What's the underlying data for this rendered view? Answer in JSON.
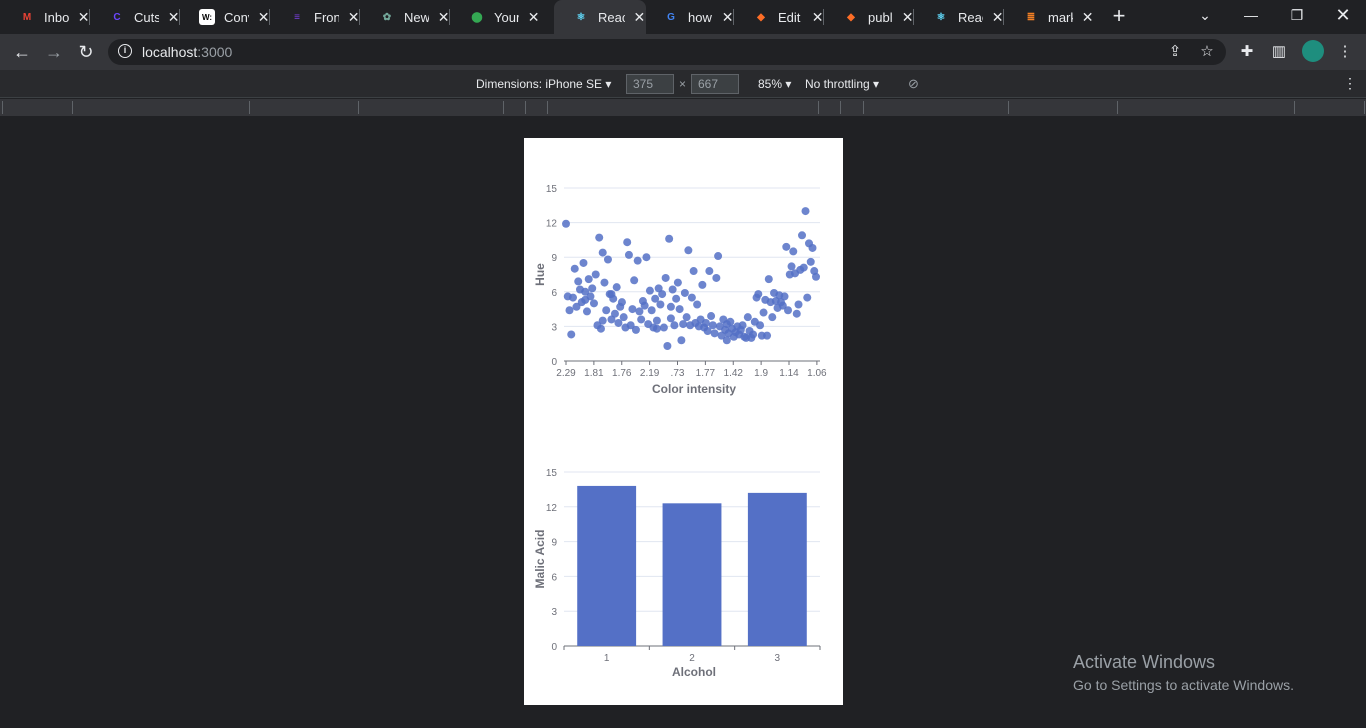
{
  "tabs": [
    {
      "title": "Inbox",
      "icon": "gmail-icon",
      "color": "#ea4335",
      "glyph": "M"
    },
    {
      "title": "Cutshort",
      "icon": "cutshort-icon",
      "color": "#6c47ff",
      "glyph": "C"
    },
    {
      "title": "Conv",
      "icon": "conv-icon",
      "color": "#ffffff",
      "glyph": "W:"
    },
    {
      "title": "Front",
      "icon": "list-icon",
      "color": "#7b3fe4",
      "glyph": "≡"
    },
    {
      "title": "New",
      "icon": "openai-icon",
      "color": "#74aa9c",
      "glyph": "✿"
    },
    {
      "title": "Your",
      "icon": "maps-pin-icon",
      "color": "#34a853",
      "glyph": "⬤"
    },
    {
      "title": "React",
      "icon": "react-icon",
      "color": "#61dafb",
      "glyph": "⚛"
    },
    {
      "title": "how",
      "icon": "google-icon",
      "color": "#4285f4",
      "glyph": "G"
    },
    {
      "title": "Edit",
      "icon": "gitlab-icon",
      "color": "#fc6d26",
      "glyph": "◆"
    },
    {
      "title": "publ",
      "icon": "gitlab-icon",
      "color": "#fc6d26",
      "glyph": "◆"
    },
    {
      "title": "React",
      "icon": "react-icon",
      "color": "#61dafb",
      "glyph": "⚛"
    },
    {
      "title": "mark",
      "icon": "stackoverflow-icon",
      "color": "#f48024",
      "glyph": "≣"
    }
  ],
  "address": {
    "host": "localhost",
    "port": ":3000"
  },
  "device_toolbar": {
    "dimensions_label": "Dimensions: iPhone SE",
    "width": "375",
    "times": "×",
    "height": "667",
    "zoom": "85%",
    "throttling": "No throttling"
  },
  "watermark": {
    "title": "Activate Windows",
    "subtitle": "Go to Settings to activate Windows."
  },
  "chart_data": [
    {
      "type": "scatter",
      "xlabel": "Color intensity",
      "ylabel": "Hue",
      "ylim": [
        0,
        15
      ],
      "yticks": [
        0,
        3,
        6,
        9,
        12,
        15
      ],
      "x_categories": [
        "2.29",
        "1.81",
        "1.76",
        "2.19",
        ".73",
        "1.77",
        "1.42",
        "1.9",
        "1.14",
        "1.06"
      ],
      "grid": true,
      "color": "#5470c6",
      "points": [
        [
          0.0,
          11.9
        ],
        [
          0.05,
          5.6
        ],
        [
          0.1,
          4.4
        ],
        [
          0.15,
          2.3
        ],
        [
          0.2,
          5.5
        ],
        [
          0.25,
          8
        ],
        [
          0.3,
          4.7
        ],
        [
          0.35,
          6.9
        ],
        [
          0.4,
          6.2
        ],
        [
          0.45,
          5.1
        ],
        [
          0.5,
          8.5
        ],
        [
          0.55,
          5.3
        ],
        [
          0.6,
          4.3
        ],
        [
          0.65,
          7.1
        ],
        [
          0.7,
          5.6
        ],
        [
          0.75,
          6.3
        ],
        [
          0.8,
          5
        ],
        [
          0.85,
          7.5
        ],
        [
          0.9,
          3.1
        ],
        [
          0.95,
          10.7
        ],
        [
          1.0,
          2.8
        ],
        [
          1.05,
          9.4
        ],
        [
          1.1,
          6.8
        ],
        [
          1.15,
          4.4
        ],
        [
          1.2,
          8.8
        ],
        [
          1.25,
          5.8
        ],
        [
          1.3,
          3.6
        ],
        [
          1.35,
          5.4
        ],
        [
          1.4,
          4.1
        ],
        [
          1.45,
          6.4
        ],
        [
          1.5,
          3.3
        ],
        [
          1.55,
          4.7
        ],
        [
          1.6,
          5.1
        ],
        [
          1.65,
          3.8
        ],
        [
          1.7,
          2.9
        ],
        [
          1.75,
          10.3
        ],
        [
          1.8,
          9.2
        ],
        [
          1.85,
          3.1
        ],
        [
          1.9,
          4.5
        ],
        [
          1.95,
          7
        ],
        [
          2.0,
          2.7
        ],
        [
          2.05,
          8.7
        ],
        [
          2.1,
          4.3
        ],
        [
          2.15,
          3.6
        ],
        [
          2.2,
          5.2
        ],
        [
          2.25,
          4.8
        ],
        [
          2.3,
          9
        ],
        [
          2.35,
          3.2
        ],
        [
          2.4,
          6.1
        ],
        [
          2.45,
          4.4
        ],
        [
          2.5,
          2.9
        ],
        [
          2.55,
          5.4
        ],
        [
          2.6,
          3.5
        ],
        [
          2.65,
          6.3
        ],
        [
          2.7,
          4.9
        ],
        [
          2.75,
          5.8
        ],
        [
          2.8,
          2.9
        ],
        [
          2.85,
          7.2
        ],
        [
          2.9,
          1.3
        ],
        [
          2.95,
          10.6
        ],
        [
          3.0,
          3.7
        ],
        [
          3.05,
          6.2
        ],
        [
          3.1,
          3.1
        ],
        [
          3.15,
          5.4
        ],
        [
          3.2,
          6.8
        ],
        [
          3.25,
          4.5
        ],
        [
          3.3,
          1.8
        ],
        [
          3.35,
          3.2
        ],
        [
          3.4,
          5.9
        ],
        [
          3.45,
          3.8
        ],
        [
          3.5,
          9.6
        ],
        [
          3.55,
          3.1
        ],
        [
          3.6,
          5.5
        ],
        [
          3.65,
          7.8
        ],
        [
          3.7,
          3.3
        ],
        [
          3.75,
          4.9
        ],
        [
          3.8,
          3
        ],
        [
          3.85,
          3.6
        ],
        [
          3.9,
          6.6
        ],
        [
          3.95,
          2.9
        ],
        [
          4.0,
          3.3
        ],
        [
          4.05,
          2.6
        ],
        [
          4.1,
          7.8
        ],
        [
          4.15,
          3.9
        ],
        [
          4.2,
          3.1
        ],
        [
          4.25,
          2.4
        ],
        [
          4.3,
          7.2
        ],
        [
          4.35,
          9.1
        ],
        [
          4.4,
          3
        ],
        [
          4.45,
          2.2
        ],
        [
          4.5,
          3.6
        ],
        [
          4.55,
          2.7
        ],
        [
          4.6,
          1.8
        ],
        [
          4.65,
          2.4
        ],
        [
          4.7,
          3.4
        ],
        [
          4.75,
          2.8
        ],
        [
          4.8,
          2.1
        ],
        [
          4.85,
          2.5
        ],
        [
          4.9,
          3
        ],
        [
          4.95,
          2.3
        ],
        [
          5.0,
          2.7
        ],
        [
          5.05,
          3.1
        ],
        [
          5.1,
          2.1
        ],
        [
          5.15,
          2
        ],
        [
          5.2,
          3.8
        ],
        [
          5.25,
          2.6
        ],
        [
          5.3,
          2
        ],
        [
          5.35,
          2.3
        ],
        [
          5.4,
          3.4
        ],
        [
          5.45,
          5.5
        ],
        [
          5.5,
          5.8
        ],
        [
          5.55,
          3.1
        ],
        [
          5.6,
          2.2
        ],
        [
          5.65,
          4.2
        ],
        [
          5.7,
          5.3
        ],
        [
          5.75,
          2.2
        ],
        [
          5.8,
          7.1
        ],
        [
          5.85,
          5.1
        ],
        [
          5.9,
          3.8
        ],
        [
          5.95,
          5.9
        ],
        [
          6.0,
          5.2
        ],
        [
          6.05,
          4.6
        ],
        [
          6.1,
          5.7
        ],
        [
          6.15,
          5.1
        ],
        [
          6.2,
          4.8
        ],
        [
          6.25,
          5.6
        ],
        [
          6.3,
          9.9
        ],
        [
          6.35,
          4.4
        ],
        [
          6.4,
          7.5
        ],
        [
          6.45,
          8.2
        ],
        [
          6.5,
          9.5
        ],
        [
          6.55,
          7.6
        ],
        [
          6.6,
          4.1
        ],
        [
          6.65,
          4.9
        ],
        [
          6.7,
          7.9
        ],
        [
          6.75,
          10.9
        ],
        [
          6.8,
          8.1
        ],
        [
          6.85,
          13
        ],
        [
          6.9,
          5.5
        ],
        [
          6.95,
          10.2
        ],
        [
          7.0,
          8.6
        ],
        [
          7.05,
          9.8
        ],
        [
          7.1,
          7.8
        ],
        [
          7.15,
          7.3
        ],
        [
          1.05,
          3.5
        ],
        [
          2.6,
          2.8
        ],
        [
          1.3,
          5.8
        ],
        [
          0.55,
          6
        ],
        [
          3.0,
          4.7
        ],
        [
          4.6,
          3.2
        ]
      ],
      "xrange": [
        0,
        7.15
      ]
    },
    {
      "type": "bar",
      "xlabel": "Alcohol",
      "ylabel": "Malic Acid",
      "ylim": [
        0,
        15
      ],
      "yticks": [
        0,
        3,
        6,
        9,
        12,
        15
      ],
      "categories": [
        "1",
        "2",
        "3"
      ],
      "values": [
        13.8,
        12.3,
        13.2
      ],
      "grid": true,
      "color": "#5470c6"
    }
  ]
}
